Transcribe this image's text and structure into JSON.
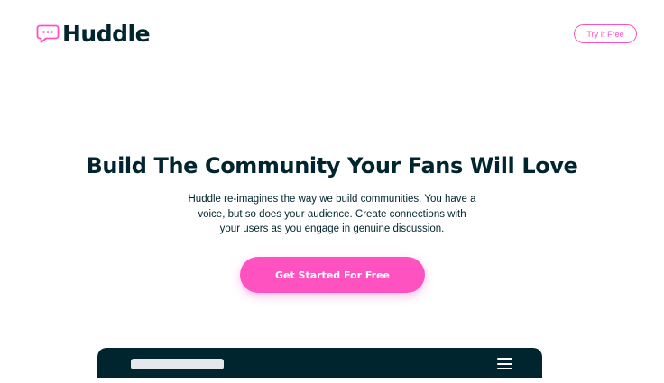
{
  "header": {
    "logo_text": "Huddle",
    "logo_icon": "chat-bubble-icon",
    "try_button_label": "Try It Free"
  },
  "hero": {
    "title": "Build The Community Your Fans Will Love",
    "description": "Huddle re-imagines the way we build communities. You have a voice, but so does your audience. Create connections with your users as you engage in genuine discussion.",
    "cta_label": "Get Started For Free"
  },
  "mockup": {
    "menu_icon": "hamburger-menu-icon"
  },
  "colors": {
    "accent": "#ff52c1",
    "dark": "#00252e"
  }
}
